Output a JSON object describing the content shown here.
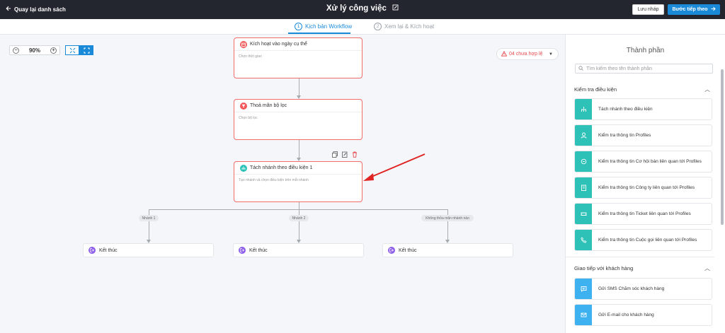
{
  "topbar": {
    "back_label": "Quay lại danh sách",
    "title": "Xử lý công việc",
    "draft_button": "Lưu nháp",
    "next_button": "Bước tiếp theo"
  },
  "stepper": {
    "steps": [
      {
        "num": "1",
        "label": "Kịch bản Workflow",
        "active": true
      },
      {
        "num": "2",
        "label": "Xem lại & Kích hoạt",
        "active": false
      }
    ]
  },
  "canvas": {
    "zoom": "90%",
    "invalid_badge": "04 chưa hợp lệ",
    "nodes": [
      {
        "title": "Kích hoạt vào ngày cụ thể",
        "subtitle": "Chọn thời gian"
      },
      {
        "title": "Thoả mãn bộ lọc",
        "subtitle": "Chọn bộ lọc"
      },
      {
        "title": "Tách nhánh theo điều kiện 1",
        "subtitle": "Tạo nhánh và chọn điều kiện trên mỗi nhánh"
      }
    ],
    "branch_labels": [
      "Nhánh 1",
      "Nhánh 2",
      "Không thỏa mãn nhánh nào"
    ],
    "end_nodes": [
      "Kết thúc",
      "Kết thúc",
      "Kết thúc"
    ]
  },
  "panel": {
    "title": "Thành phần",
    "search_placeholder": "Tìm kiếm theo tên thành phần",
    "sections": [
      {
        "title": "Kiểm tra điều kiện",
        "items": [
          "Tách nhánh theo điều kiện",
          "Kiểm tra thông tin Profiles",
          "Kiểm tra thông tin Cơ hội bán liên quan tới Profiles",
          "Kiểm tra thông tin Công ty liên quan tới Profiles",
          "Kiểm tra thông tin Ticket liên quan tới Profiles",
          "Kiểm tra thông tin Cuộc gọi liên quan tới Profiles"
        ]
      },
      {
        "title": "Giao tiếp với khách hàng",
        "items": [
          "Gửi SMS Chăm sóc khách hàng",
          "Gửi E-mail cho khách hàng"
        ]
      }
    ]
  },
  "colors": {
    "accent": "#1a8ad8",
    "topbar": "#23252f",
    "error": "#f26c6c",
    "teal": "#2dc1b7",
    "purple": "#8c5de8"
  }
}
